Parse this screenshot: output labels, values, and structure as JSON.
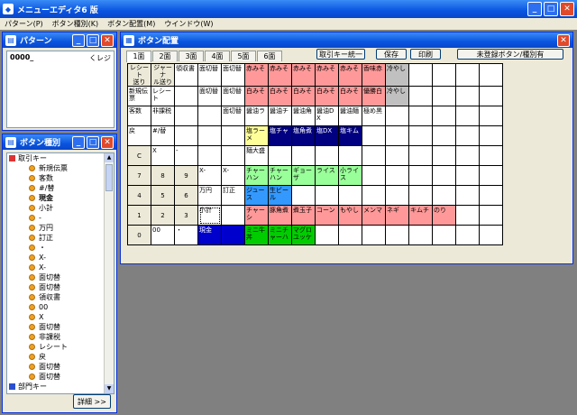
{
  "app": {
    "title": "メニューエディタ6 版",
    "menu": [
      "パターン(P)",
      "ボタン種別(K)",
      "ボタン配置(M)",
      "ウインドウ(W)"
    ]
  },
  "pattern_window": {
    "title": "パターン",
    "items": [
      {
        "code": "0000_",
        "name": "くレジ"
      }
    ]
  },
  "button_type_window": {
    "title": "ボタン種別",
    "detail_label": "詳細 >>",
    "tree": [
      {
        "level": 0,
        "label": "取引キー",
        "kind": "root",
        "color": "#dd3333"
      },
      {
        "level": 1,
        "label": "新規伝票"
      },
      {
        "level": 1,
        "label": "客数"
      },
      {
        "level": 1,
        "label": "#/替"
      },
      {
        "level": 1,
        "label": "現金",
        "bold": true
      },
      {
        "level": 1,
        "label": "小計"
      },
      {
        "level": 1,
        "label": "-"
      },
      {
        "level": 1,
        "label": "万円"
      },
      {
        "level": 1,
        "label": "訂正"
      },
      {
        "level": 1,
        "label": "・"
      },
      {
        "level": 1,
        "label": "X-"
      },
      {
        "level": 1,
        "label": "X-"
      },
      {
        "level": 1,
        "label": "面切替"
      },
      {
        "level": 1,
        "label": "面切替"
      },
      {
        "level": 1,
        "label": "領収書"
      },
      {
        "level": 1,
        "label": "00"
      },
      {
        "level": 1,
        "label": "X"
      },
      {
        "level": 1,
        "label": "面切替"
      },
      {
        "level": 1,
        "label": "非課税"
      },
      {
        "level": 1,
        "label": "レシート"
      },
      {
        "level": 1,
        "label": "戻"
      },
      {
        "level": 1,
        "label": "面切替"
      },
      {
        "level": 1,
        "label": "面切替"
      },
      {
        "level": 0,
        "label": "部門キー",
        "kind": "root",
        "color": "#2a4fd0"
      }
    ]
  },
  "editor_window": {
    "title": "ボタン配置",
    "tabs": [
      "1面",
      "2面",
      "3面",
      "4面",
      "5面",
      "6面"
    ],
    "active_tab": 0,
    "buttons": {
      "unify": "取引キー統一",
      "save": "保存",
      "print": "印刷",
      "unregistered": "未登録ボタン/種別有"
    },
    "grid": [
      [
        {
          "t": "レシート\n送り",
          "bg": "#ece9d8",
          "center": true
        },
        {
          "t": "ジャーナ\nル送り",
          "bg": "#ece9d8",
          "center": true
        },
        {
          "t": "領収書"
        },
        {
          "t": "面切替"
        },
        {
          "t": "面切替"
        },
        {
          "t": "赤みそ",
          "bg": "#ff9999"
        },
        {
          "t": "赤みそ",
          "bg": "#ff9999"
        },
        {
          "t": "赤みそ",
          "bg": "#ff9999"
        },
        {
          "t": "赤みそ",
          "bg": "#ff9999"
        },
        {
          "t": "赤みそ",
          "bg": "#ff9999"
        },
        {
          "t": "香味赤",
          "bg": "#ff9999"
        },
        {
          "t": "冷やし",
          "bg": "#c0c0c0"
        },
        {
          "t": ""
        },
        {
          "t": ""
        },
        {
          "t": ""
        },
        {
          "t": ""
        }
      ],
      [
        {
          "t": "新規伝\n票"
        },
        {
          "t": "レシート"
        },
        {
          "t": ""
        },
        {
          "t": "面切替"
        },
        {
          "t": "面切替"
        },
        {
          "t": "白みそ",
          "bg": "#ff9999"
        },
        {
          "t": "白みそ",
          "bg": "#ff9999"
        },
        {
          "t": "白みそ",
          "bg": "#ff9999"
        },
        {
          "t": "白みそ",
          "bg": "#ff9999"
        },
        {
          "t": "白みそ",
          "bg": "#ff9999"
        },
        {
          "t": "優勝白",
          "bg": "#ff9999"
        },
        {
          "t": "冷やし",
          "bg": "#c0c0c0"
        },
        {
          "t": ""
        },
        {
          "t": ""
        },
        {
          "t": ""
        },
        {
          "t": ""
        }
      ],
      [
        {
          "t": "客数"
        },
        {
          "t": "非課税"
        },
        {
          "t": ""
        },
        {
          "t": ""
        },
        {
          "t": "面切替"
        },
        {
          "t": "醤油ラ",
          "bg": "#ffffff"
        },
        {
          "t": "醤油チ",
          "bg": "#ffffff"
        },
        {
          "t": "醤油角",
          "bg": "#ffffff"
        },
        {
          "t": "醤油DX",
          "bg": "#ffffff"
        },
        {
          "t": "醤油麺",
          "bg": "#ffffff"
        },
        {
          "t": "極め黒",
          "bg": "#ffffff"
        },
        {
          "t": ""
        },
        {
          "t": ""
        },
        {
          "t": ""
        },
        {
          "t": ""
        },
        {
          "t": ""
        }
      ],
      [
        {
          "t": "戻"
        },
        {
          "t": "#/替"
        },
        {
          "t": ""
        },
        {
          "t": ""
        },
        {
          "t": ""
        },
        {
          "t": "塩ラーメ",
          "bg": "#ffff99"
        },
        {
          "t": "塩チャ",
          "bg": "#000080",
          "color": "#ffffff"
        },
        {
          "t": "塩角煮",
          "bg": "#000080",
          "color": "#ffffff"
        },
        {
          "t": "塩DX",
          "bg": "#000080",
          "color": "#ffffff"
        },
        {
          "t": "塩キム",
          "bg": "#000080",
          "color": "#ffffff"
        },
        {
          "t": ""
        },
        {
          "t": ""
        },
        {
          "t": ""
        },
        {
          "t": ""
        },
        {
          "t": ""
        },
        {
          "t": ""
        }
      ],
      [
        {
          "t": "C",
          "bg": "#ece9d8",
          "center": true
        },
        {
          "t": "X"
        },
        {
          "t": "-"
        },
        {
          "t": ""
        },
        {
          "t": ""
        },
        {
          "t": "麺大盛"
        },
        {
          "t": ""
        },
        {
          "t": ""
        },
        {
          "t": ""
        },
        {
          "t": ""
        },
        {
          "t": ""
        },
        {
          "t": ""
        },
        {
          "t": ""
        },
        {
          "t": ""
        },
        {
          "t": ""
        },
        {
          "t": ""
        }
      ],
      [
        {
          "t": "7",
          "bg": "#ece9d8",
          "center": true
        },
        {
          "t": "8",
          "bg": "#ece9d8",
          "center": true
        },
        {
          "t": "9",
          "bg": "#ece9d8",
          "center": true
        },
        {
          "t": "X-"
        },
        {
          "t": "X-"
        },
        {
          "t": "チャーハン",
          "bg": "#99ff99"
        },
        {
          "t": "チャーハン",
          "bg": "#99ff99"
        },
        {
          "t": "ギョーザ",
          "bg": "#99ff99"
        },
        {
          "t": "ライス",
          "bg": "#99ff99"
        },
        {
          "t": "小ライス",
          "bg": "#99ff99"
        },
        {
          "t": ""
        },
        {
          "t": ""
        },
        {
          "t": ""
        },
        {
          "t": ""
        },
        {
          "t": ""
        },
        {
          "t": ""
        }
      ],
      [
        {
          "t": "4",
          "bg": "#ece9d8",
          "center": true
        },
        {
          "t": "5",
          "bg": "#ece9d8",
          "center": true
        },
        {
          "t": "6",
          "bg": "#ece9d8",
          "center": true
        },
        {
          "t": "万円"
        },
        {
          "t": "訂正"
        },
        {
          "t": "ジュース",
          "bg": "#3399ff"
        },
        {
          "t": "生ビール",
          "bg": "#3399ff"
        },
        {
          "t": ""
        },
        {
          "t": ""
        },
        {
          "t": ""
        },
        {
          "t": ""
        },
        {
          "t": ""
        },
        {
          "t": ""
        },
        {
          "t": ""
        },
        {
          "t": ""
        },
        {
          "t": ""
        }
      ],
      [
        {
          "t": "1",
          "bg": "#ece9d8",
          "center": true
        },
        {
          "t": "2",
          "bg": "#ece9d8",
          "center": true
        },
        {
          "t": "3",
          "bg": "#ece9d8",
          "center": true
        },
        {
          "t": "小計",
          "selected": true
        },
        {
          "t": ""
        },
        {
          "t": "チャーシ",
          "bg": "#ff9999"
        },
        {
          "t": "豚角煮",
          "bg": "#ff9999"
        },
        {
          "t": "煮玉子",
          "bg": "#ff9999"
        },
        {
          "t": "コーン",
          "bg": "#ff9999"
        },
        {
          "t": "もやし",
          "bg": "#ff9999"
        },
        {
          "t": "メンマ",
          "bg": "#ff9999"
        },
        {
          "t": "ネギ",
          "bg": "#ff9999"
        },
        {
          "t": "キムチ",
          "bg": "#ff9999"
        },
        {
          "t": "のり",
          "bg": "#ff9999"
        },
        {
          "t": ""
        },
        {
          "t": ""
        }
      ],
      [
        {
          "t": "0",
          "bg": "#ece9d8",
          "center": true
        },
        {
          "t": "00"
        },
        {
          "t": "・"
        },
        {
          "t": "現金",
          "bg": "#0000cc",
          "color": "#ffffff"
        },
        {
          "t": "",
          "bg": "#0000cc"
        },
        {
          "t": "ミニ牛丼",
          "bg": "#00cc00"
        },
        {
          "t": "ミニチャーハ",
          "bg": "#00cc00"
        },
        {
          "t": "マグロユッケ",
          "bg": "#00cc00"
        },
        {
          "t": ""
        },
        {
          "t": ""
        },
        {
          "t": ""
        },
        {
          "t": ""
        },
        {
          "t": ""
        },
        {
          "t": ""
        },
        {
          "t": ""
        },
        {
          "t": ""
        }
      ]
    ]
  }
}
